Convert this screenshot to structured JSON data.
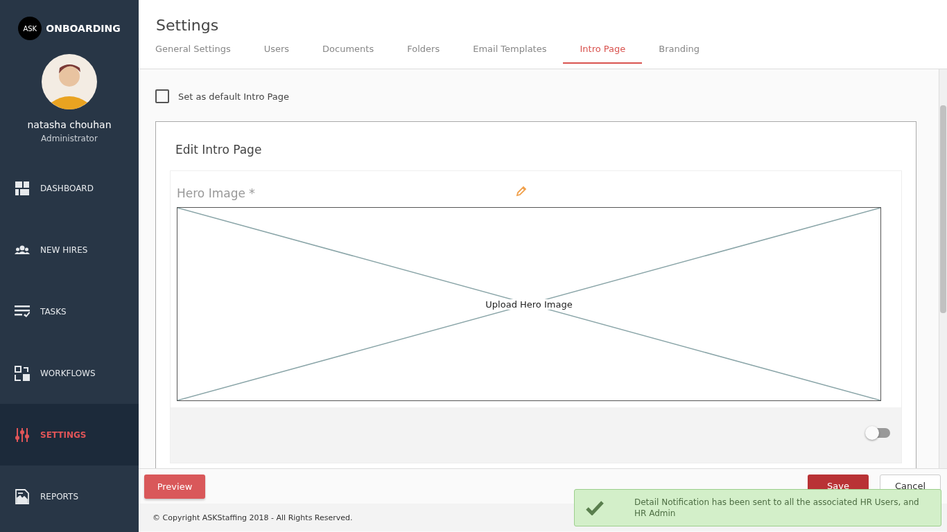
{
  "brand": {
    "logo": "ASK",
    "name": "ONBOARDING"
  },
  "user": {
    "name": "natasha chouhan",
    "role": "Administrator"
  },
  "nav": [
    {
      "label": "DASHBOARD",
      "kind": "dashboard",
      "selected": false
    },
    {
      "label": "NEW HIRES",
      "kind": "people",
      "selected": false
    },
    {
      "label": "TASKS",
      "kind": "tasks",
      "selected": false
    },
    {
      "label": "WORKFLOWS",
      "kind": "workflows",
      "selected": false
    },
    {
      "label": "SETTINGS",
      "kind": "settings",
      "selected": true
    },
    {
      "label": "REPORTS",
      "kind": "reports",
      "selected": false
    }
  ],
  "page_title": "Settings",
  "tabs": [
    {
      "label": "General Settings",
      "selected": false
    },
    {
      "label": "Users",
      "selected": false
    },
    {
      "label": "Documents",
      "selected": false
    },
    {
      "label": "Folders",
      "selected": false
    },
    {
      "label": "Email Templates",
      "selected": false
    },
    {
      "label": "Intro Page",
      "selected": true
    },
    {
      "label": "Branding",
      "selected": false
    }
  ],
  "default_checkbox": {
    "label": "Set as default Intro Page",
    "checked": false
  },
  "card": {
    "title": "Edit Intro Page",
    "hero_label": "Hero Image *",
    "upload_text": "Upload Hero Image",
    "toggle_on": false
  },
  "buttons": {
    "preview": "Preview",
    "save": "Save",
    "cancel": "Cancel"
  },
  "footer": "© Copyright ASKStaffing 2018 - All Rights Reserved.",
  "toast": {
    "message": "Detail Notification has been sent to all the associated HR Users, and HR Admin"
  }
}
